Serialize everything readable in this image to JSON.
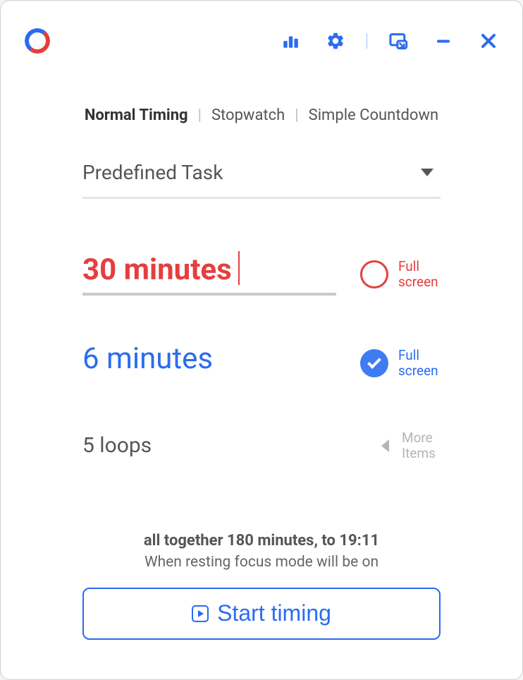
{
  "modes": {
    "normal": "Normal Timing",
    "stopwatch": "Stopwatch",
    "simple": "Simple Countdown"
  },
  "task_select": {
    "label": "Predefined Task"
  },
  "work": {
    "duration": "30 minutes",
    "fullscreen_label": "Full screen"
  },
  "rest": {
    "duration": "6 minutes",
    "fullscreen_label": "Full screen"
  },
  "loops": {
    "value": "5 loops",
    "more_label": "More Items"
  },
  "summary": {
    "line1": "all together 180 minutes, to 19:11",
    "line2": "When resting focus mode will be on"
  },
  "start_button": "Start timing"
}
